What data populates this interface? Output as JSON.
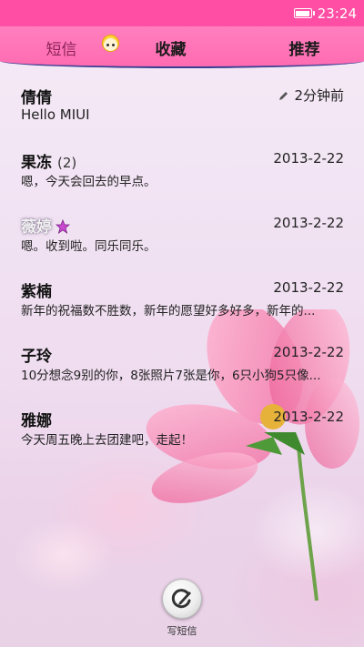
{
  "status_bar": {
    "time": "23:24",
    "battery_icon": "battery-icon"
  },
  "tabs": [
    {
      "label": "短信",
      "active": true
    },
    {
      "label": "收藏",
      "active": false
    },
    {
      "label": "推荐",
      "active": false
    }
  ],
  "messages": [
    {
      "name": "倩倩",
      "count": "",
      "time": "2分钟前",
      "preview": "Hello MIUI",
      "draft": true
    },
    {
      "name": "果冻",
      "count": "(2)",
      "time": "2013-2-22",
      "preview": "嗯，今天会回去的早点。"
    },
    {
      "name": "薇婷",
      "count": "",
      "time": "2013-2-22",
      "preview": "嗯。收到啦。同乐同乐。",
      "badge_icon": "star-icon"
    },
    {
      "name": "紫楠",
      "count": "",
      "time": "2013-2-22",
      "preview": "新年的祝福数不胜数，新年的愿望好多好多，新年的..."
    },
    {
      "name": "子玲",
      "count": "",
      "time": "2013-2-22",
      "preview": "10分想念9别的你，8张照片7张是你，6只小狗5只像..."
    },
    {
      "name": "雅娜",
      "count": "",
      "time": "2013-2-22",
      "preview": "今天周五晚上去团建吧，走起！"
    }
  ],
  "compose": {
    "label": "写短信",
    "icon": "compose-icon"
  },
  "colors": {
    "status_bar": "#ff4ea3",
    "tab_bar": "#ff73b5",
    "tab_underline": "#3a3f92"
  }
}
